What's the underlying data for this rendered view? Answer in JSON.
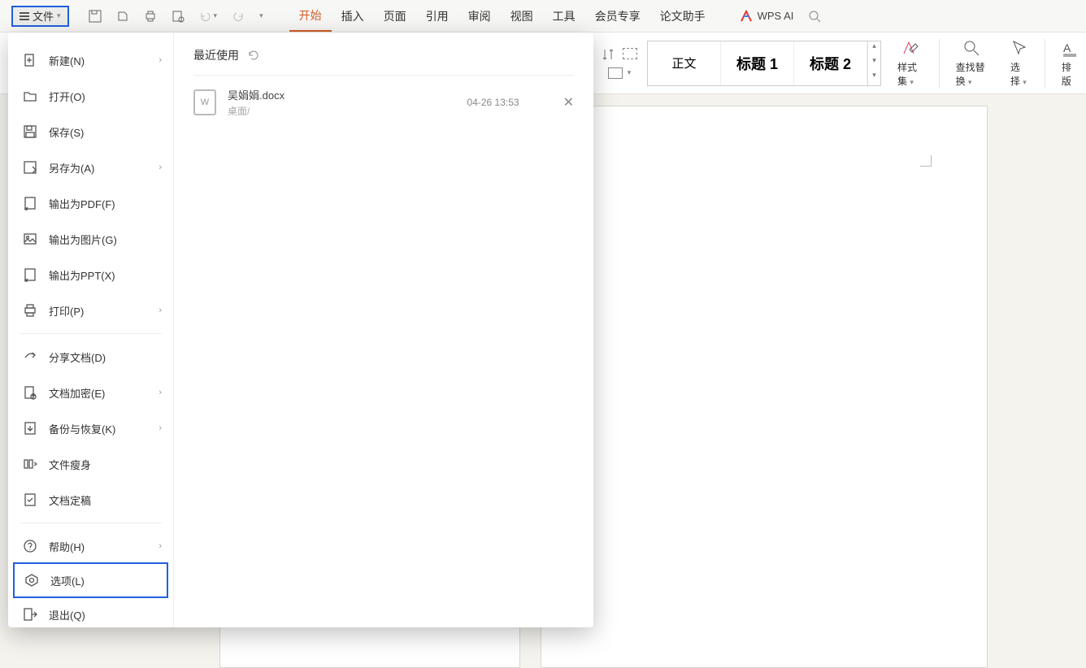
{
  "toolbar": {
    "file_label": "文件",
    "tabs": [
      "开始",
      "插入",
      "页面",
      "引用",
      "审阅",
      "视图",
      "工具",
      "会员专享",
      "论文助手"
    ],
    "active_tab_index": 0,
    "wps_ai_label": "WPS AI"
  },
  "ribbon": {
    "styles": {
      "normal": "正文",
      "heading1": "标题 1",
      "heading2": "标题 2"
    },
    "style_set_label": "样式集",
    "find_replace_label": "查找替换",
    "select_label": "选择",
    "typeset_label": "排版"
  },
  "file_menu": {
    "items": [
      {
        "label": "新建(N)",
        "icon": "new-file-icon",
        "arrow": true
      },
      {
        "label": "打开(O)",
        "icon": "open-folder-icon"
      },
      {
        "label": "保存(S)",
        "icon": "save-icon"
      },
      {
        "label": "另存为(A)",
        "icon": "save-as-icon",
        "arrow": true
      },
      {
        "label": "输出为PDF(F)",
        "icon": "export-pdf-icon"
      },
      {
        "label": "输出为图片(G)",
        "icon": "export-image-icon"
      },
      {
        "label": "输出为PPT(X)",
        "icon": "export-ppt-icon"
      },
      {
        "label": "打印(P)",
        "icon": "print-icon",
        "arrow": true,
        "sep_after": true
      },
      {
        "label": "分享文档(D)",
        "icon": "share-icon"
      },
      {
        "label": "文档加密(E)",
        "icon": "encrypt-icon",
        "arrow": true
      },
      {
        "label": "备份与恢复(K)",
        "icon": "backup-icon",
        "arrow": true
      },
      {
        "label": "文件瘦身",
        "icon": "slim-icon"
      },
      {
        "label": "文档定稿",
        "icon": "finalize-icon",
        "sep_after": true
      },
      {
        "label": "帮助(H)",
        "icon": "help-icon",
        "arrow": true
      },
      {
        "label": "选项(L)",
        "icon": "options-icon",
        "highlight": true
      },
      {
        "label": "退出(Q)",
        "icon": "exit-icon"
      }
    ]
  },
  "recent": {
    "header": "最近使用",
    "doc_name": "吴娟娟.docx",
    "doc_path": "桌面/",
    "doc_time": "04-26 13:53"
  }
}
